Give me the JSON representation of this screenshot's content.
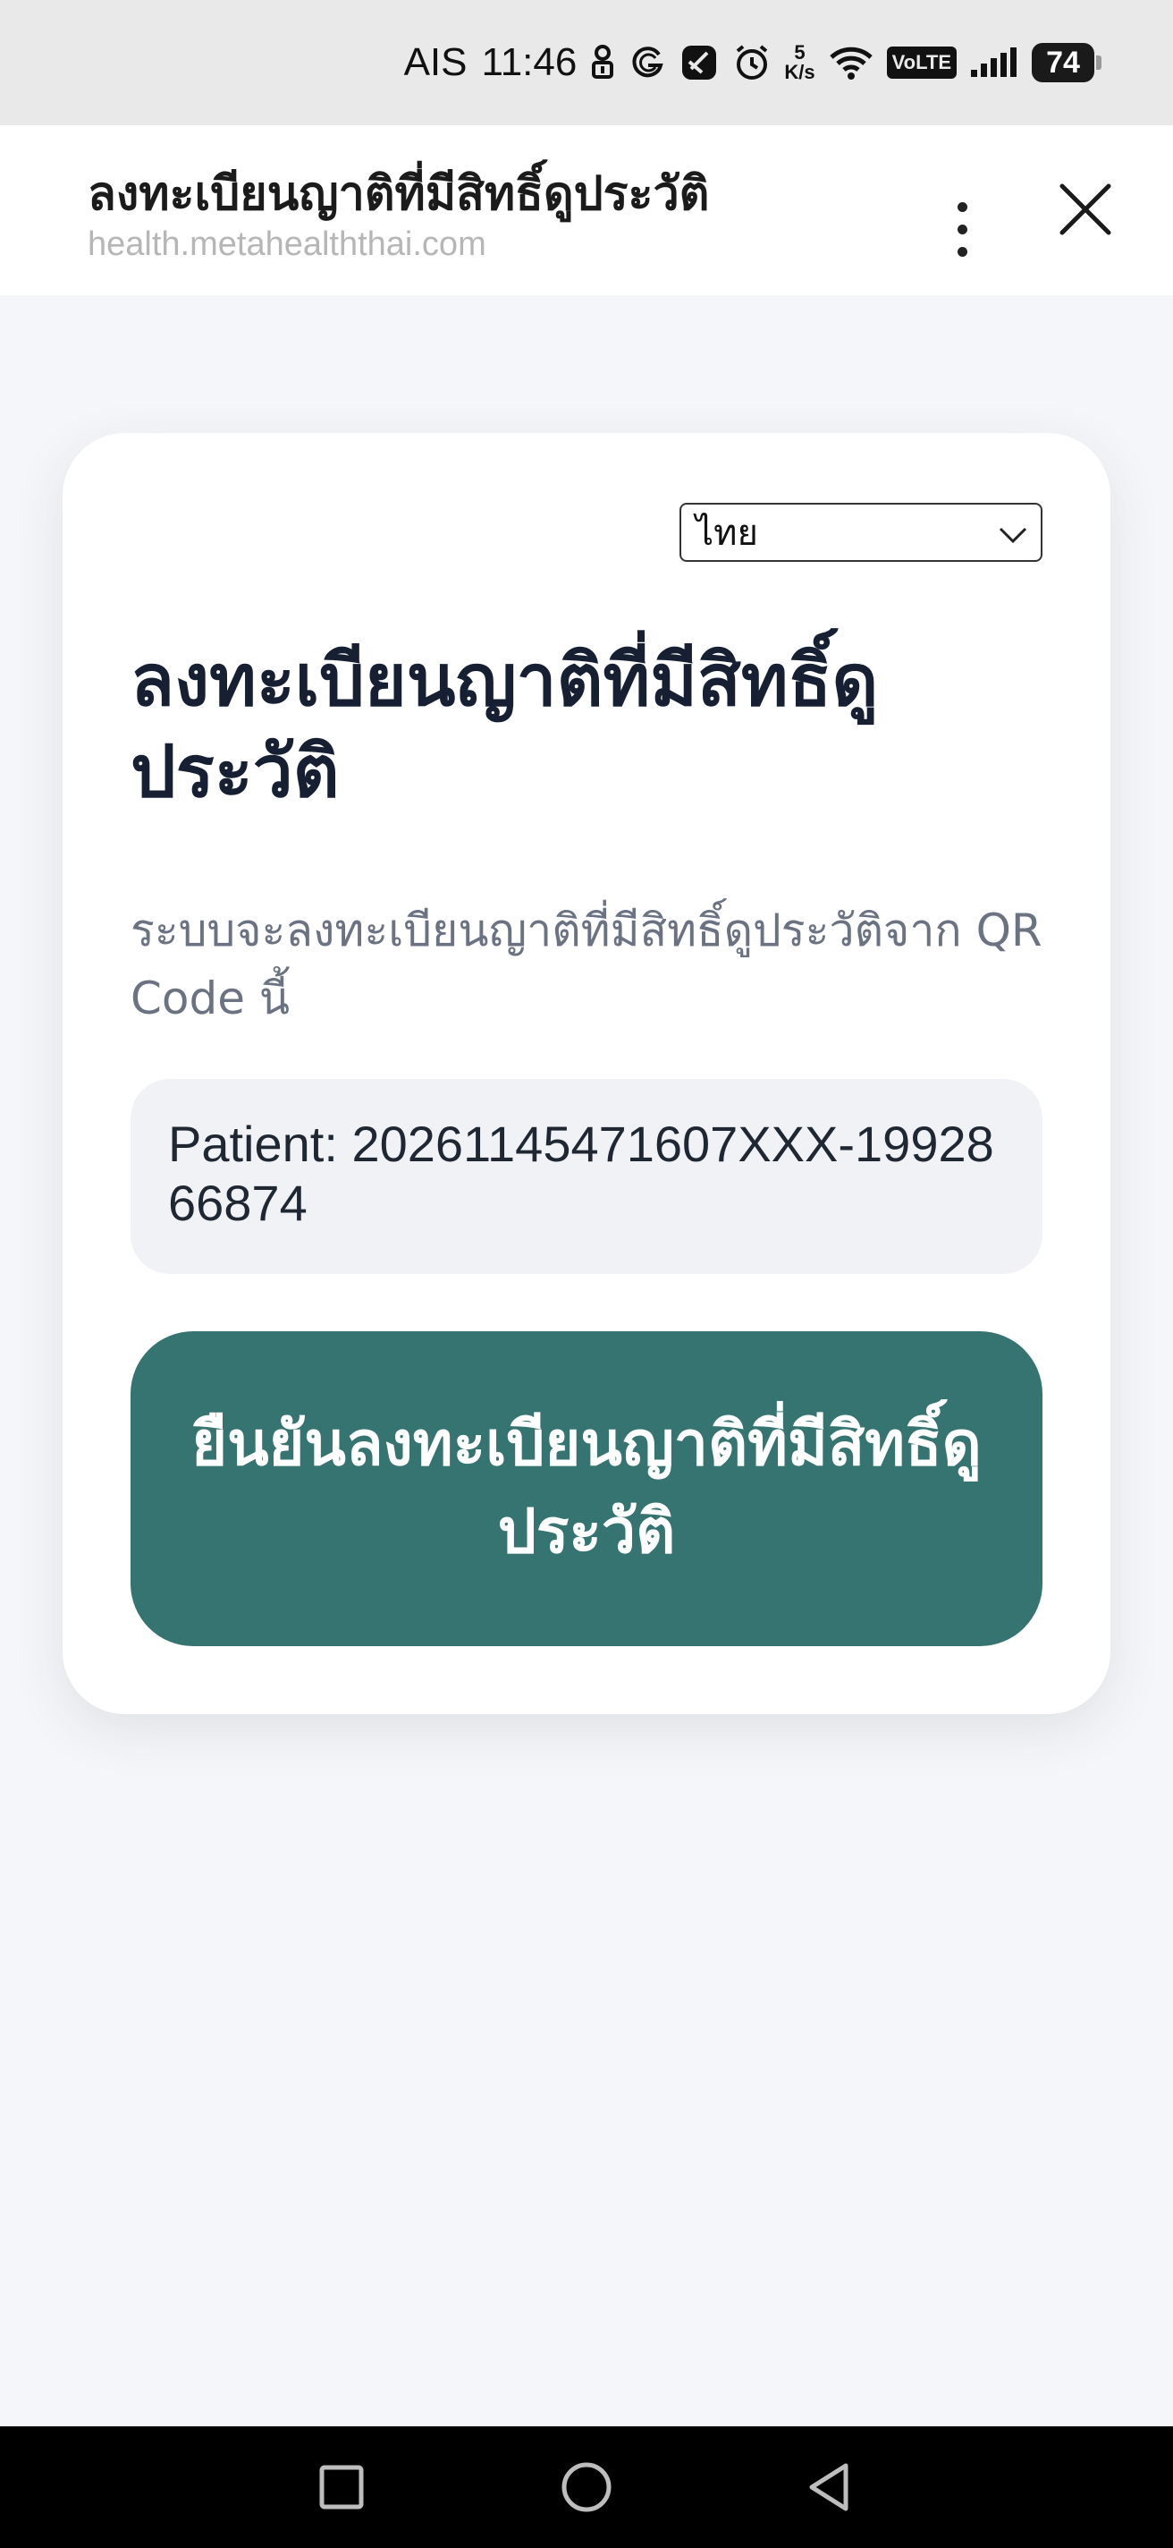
{
  "status_bar": {
    "carrier": "AIS",
    "time": "11:46",
    "net_speed_value": "5",
    "net_speed_unit": "K/s",
    "volte": "VoLTE",
    "battery": "74",
    "icons": [
      "person-icon",
      "g-icon",
      "hashtag-icon",
      "alarm-icon",
      "wifi-icon",
      "signal-icon",
      "battery-icon"
    ]
  },
  "browser": {
    "title": "ลงทะเบียนญาติที่มีสิทธิ์ดูประวัติ",
    "url": "health.metahealththai.com"
  },
  "card": {
    "language": "ไทย",
    "title": "ลงทะเบียนญาติที่มีสิทธิ์ดูประวัติ",
    "description": "ระบบจะลงทะเบียนญาติที่มีสิทธิ์ดูประวัติจาก QR Code นี้",
    "patient": "Patient: 20261145471607XXX-1992866874",
    "confirm_label": "ยืนยันลงทะเบียนญาติที่มีสิทธิ์ดูประวัติ"
  },
  "colors": {
    "accent": "#357470",
    "background": "#f5f6f9",
    "card": "#ffffff",
    "patient_box": "#f0f2f6"
  },
  "nav_bar": {
    "icons": [
      "recents-icon",
      "home-icon",
      "back-icon"
    ]
  }
}
